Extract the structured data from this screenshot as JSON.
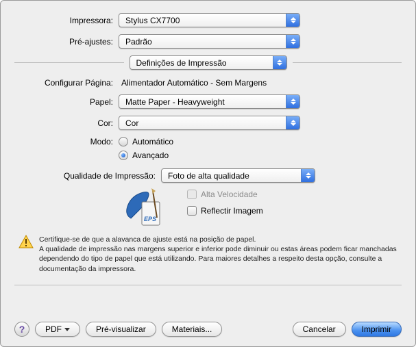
{
  "labels": {
    "printer": "Impressora:",
    "presets": "Pré-ajustes:",
    "section": "Definições de Impressão",
    "configure_page": "Configurar Página:",
    "paper": "Papel:",
    "color": "Cor:",
    "mode": "Modo:",
    "print_quality": "Qualidade de Impressão:"
  },
  "values": {
    "printer": "Stylus CX7700",
    "presets": "Padrão",
    "configure_page": "Alimentador Automático - Sem Margens",
    "paper": "Matte Paper - Heavyweight",
    "color": "Cor",
    "mode_auto": "Automático",
    "mode_advanced": "Avançado",
    "print_quality": "Foto de alta qualidade",
    "high_speed": "Alta Velocidade",
    "mirror": "Reflectir Imagem"
  },
  "warning": {
    "line1": "Certifique-se de que a alavanca de ajuste está na posição de papel.",
    "line2": "A qualidade de impressão nas margens superior e inferior pode diminuir ou estas áreas podem ficar manchadas dependendo do tipo de papel que está utilizando. Para maiores detalhes a respeito desta opção, consulte a documentação da impressora."
  },
  "buttons": {
    "help": "?",
    "pdf": "PDF",
    "preview": "Pré-visualizar",
    "supplies": "Materiais...",
    "cancel": "Cancelar",
    "print": "Imprimir"
  },
  "icons": {
    "printer_tag": "EPS"
  }
}
